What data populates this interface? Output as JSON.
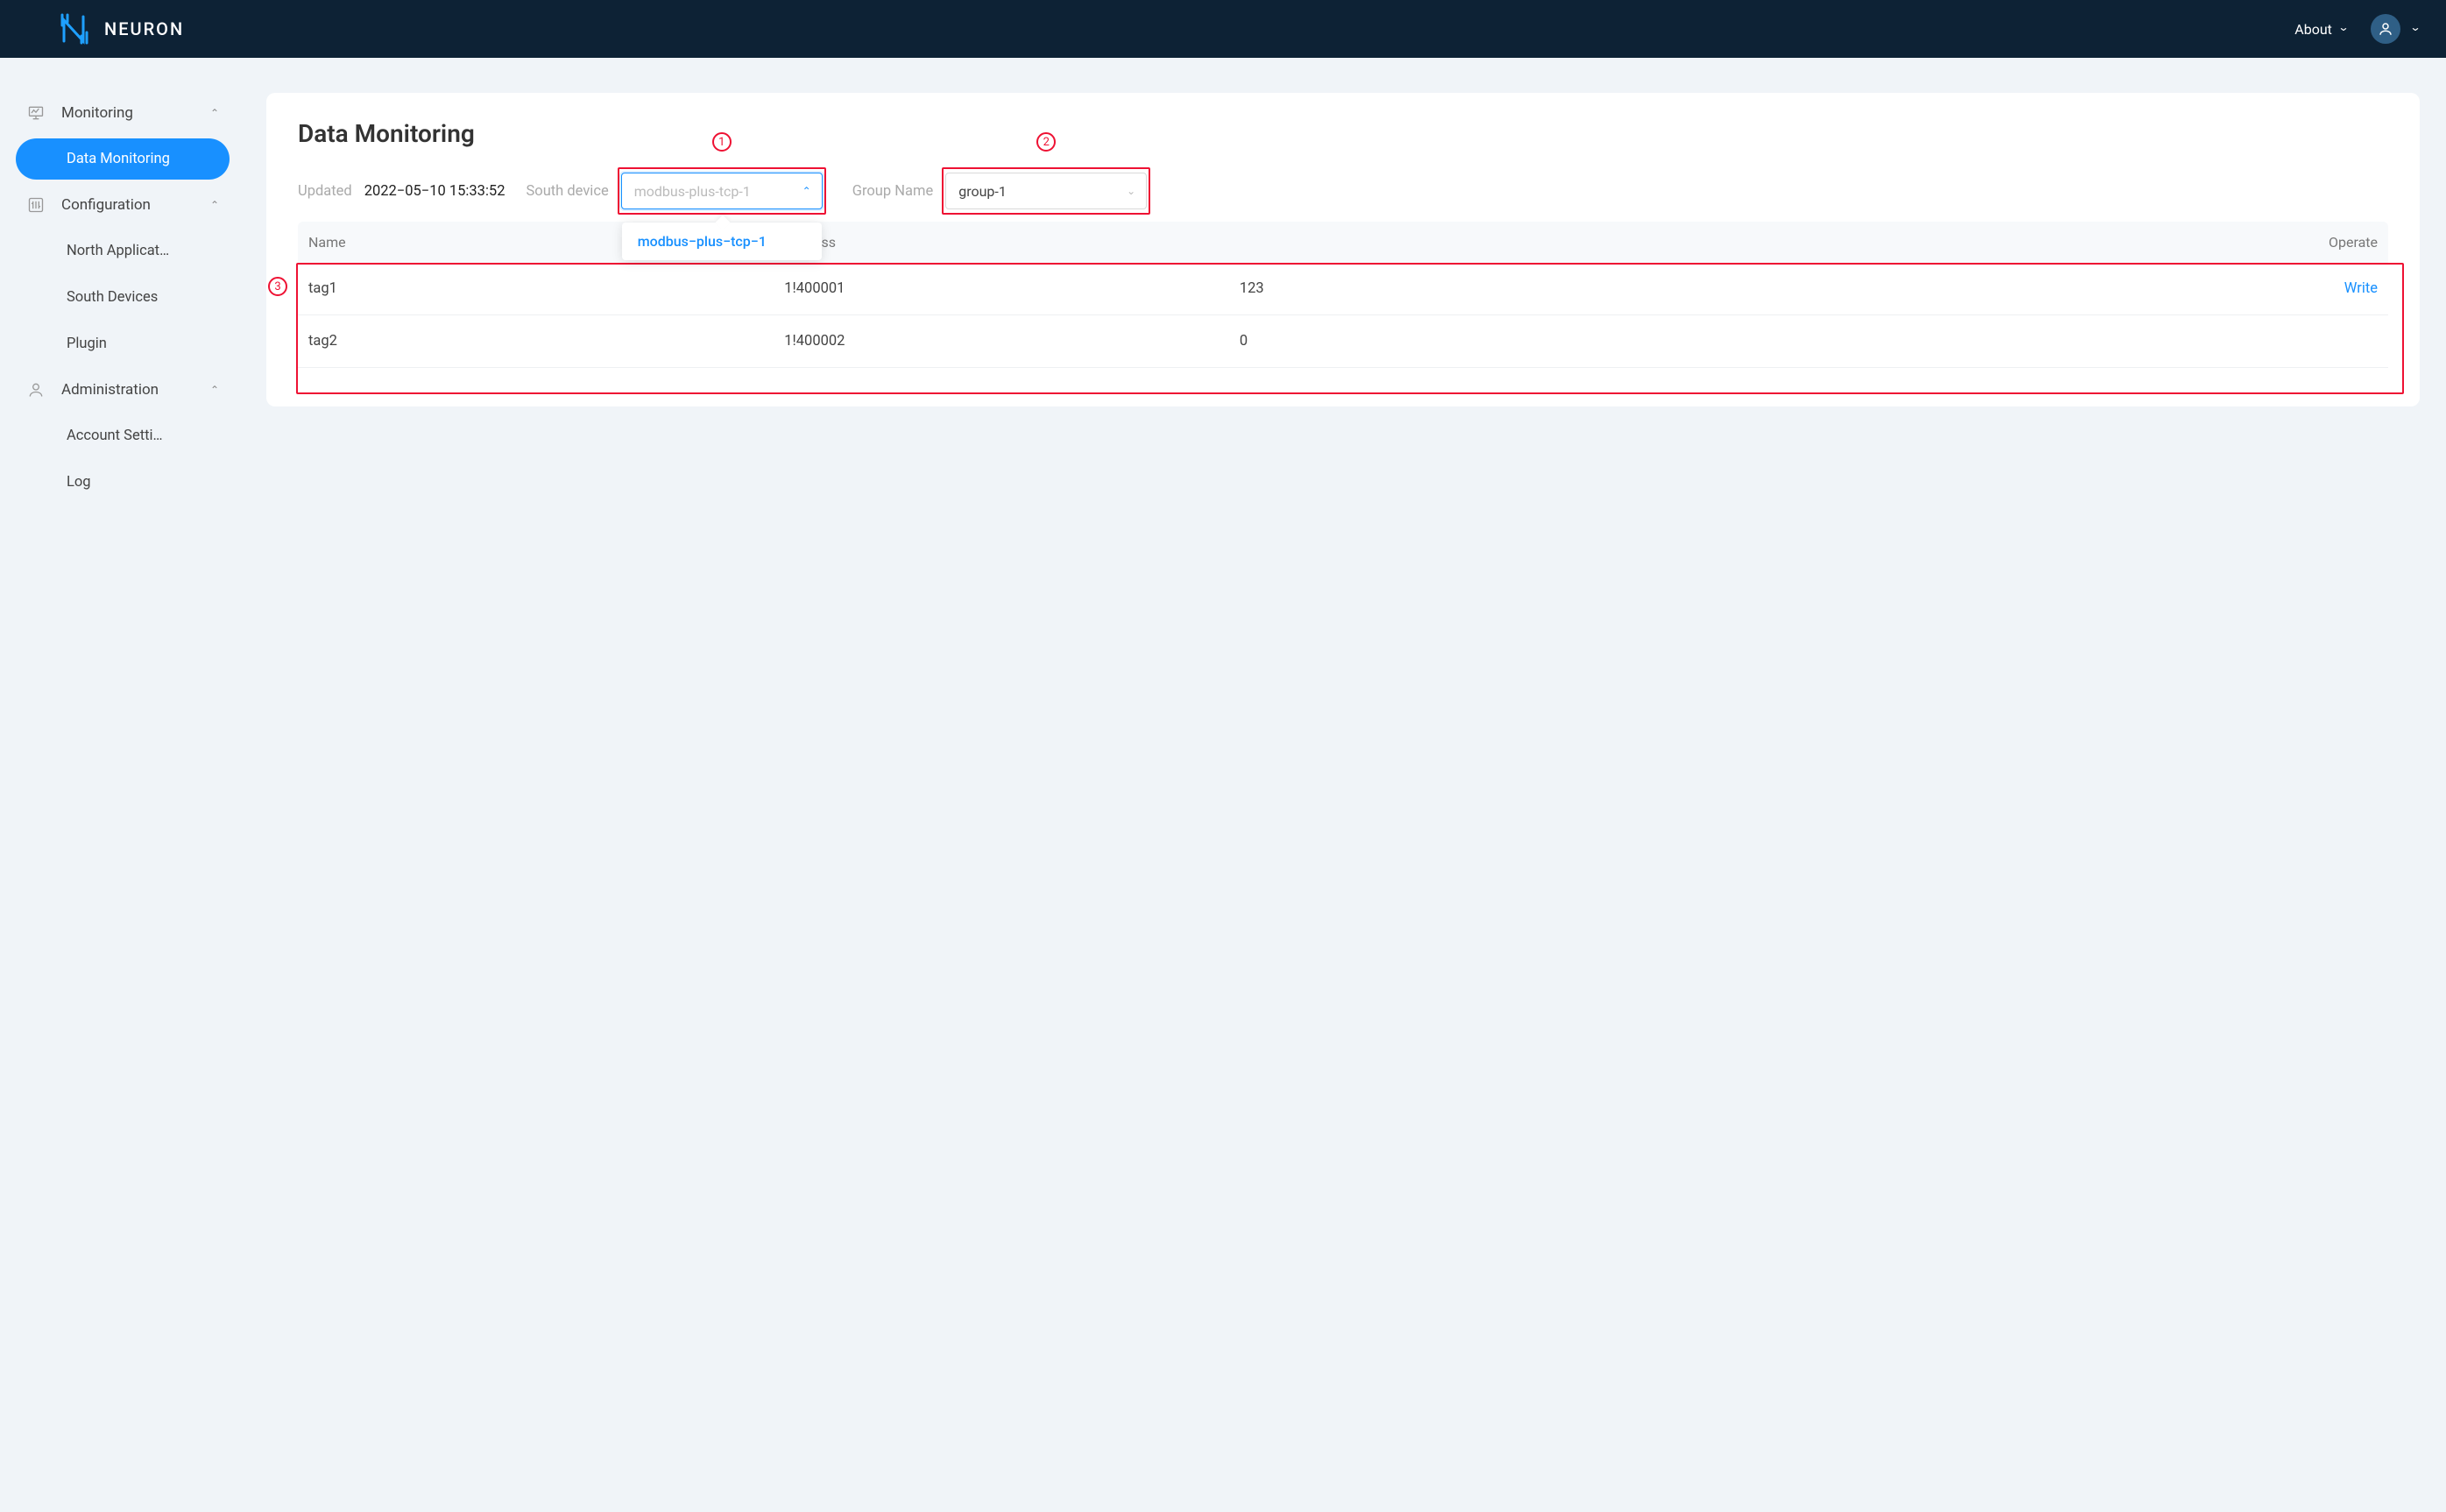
{
  "brand": {
    "name": "NEURON"
  },
  "header": {
    "about_label": "About"
  },
  "sidebar": {
    "groups": [
      {
        "label": "Monitoring",
        "items": [
          {
            "label": "Data Monitoring",
            "active": true
          }
        ]
      },
      {
        "label": "Configuration",
        "items": [
          {
            "label": "North Applicat…"
          },
          {
            "label": "South Devices"
          },
          {
            "label": "Plugin"
          }
        ]
      },
      {
        "label": "Administration",
        "items": [
          {
            "label": "Account Setti…"
          },
          {
            "label": "Log"
          }
        ]
      }
    ]
  },
  "page": {
    "title": "Data Monitoring",
    "updated_label": "Updated",
    "updated_value": "2022−05−10 15:33:52",
    "south_label": "South device",
    "south_select": {
      "placeholder": "modbus-plus-tcp-1",
      "options": [
        "modbus−plus−tcp−1"
      ]
    },
    "group_label": "Group Name",
    "group_select": {
      "value": "group-1"
    },
    "table": {
      "headers": {
        "name": "Name",
        "address": "Address",
        "operate": "Operate"
      },
      "rows": [
        {
          "name": "tag1",
          "address": "1!400001",
          "value": "123",
          "op": "Write"
        },
        {
          "name": "tag2",
          "address": "1!400002",
          "value": "0",
          "op": ""
        }
      ]
    }
  },
  "annotations": {
    "a1": "1",
    "a2": "2",
    "a3": "3"
  }
}
